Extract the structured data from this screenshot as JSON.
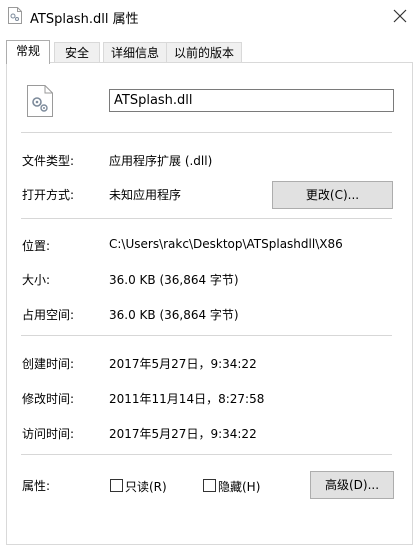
{
  "window": {
    "title": "ATSplash.dll 属性"
  },
  "tabs": [
    {
      "label": "常规",
      "active": true
    },
    {
      "label": "安全",
      "active": false
    },
    {
      "label": "详细信息",
      "active": false
    },
    {
      "label": "以前的版本",
      "active": false
    }
  ],
  "file": {
    "name": "ATSplash.dll",
    "icon": "dll-gear-file-icon"
  },
  "general": {
    "type": {
      "label": "文件类型:",
      "value": "应用程序扩展 (.dll)"
    },
    "opens_with": {
      "label": "打开方式:",
      "value": "未知应用程序",
      "button": "更改(C)..."
    },
    "location": {
      "label": "位置:",
      "value": "C:\\Users\\rakc\\Desktop\\ATSplashdll\\X86"
    },
    "size": {
      "label": "大小:",
      "value": "36.0 KB (36,864 字节)"
    },
    "size_on_disk": {
      "label": "占用空间:",
      "value": "36.0 KB (36,864 字节)"
    },
    "created": {
      "label": "创建时间:",
      "value": "2017年5月27日，9:34:22"
    },
    "modified": {
      "label": "修改时间:",
      "value": "2011年11月14日，8:27:58"
    },
    "accessed": {
      "label": "访问时间:",
      "value": "2017年5月27日，9:34:22"
    },
    "attributes": {
      "label": "属性:",
      "readonly": {
        "label": "只读(R)",
        "checked": false
      },
      "hidden": {
        "label": "隐藏(H)",
        "checked": false
      },
      "advanced_button": "高级(D)..."
    }
  },
  "colors": {
    "separator": "#d7d7d7",
    "button_bg": "#e1e1e1",
    "button_border": "#adadad"
  }
}
